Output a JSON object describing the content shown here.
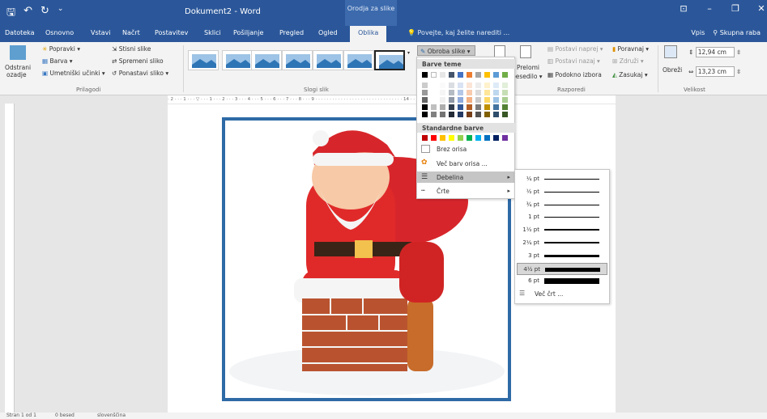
{
  "titlebar": {
    "title": "Dokument2 - Word",
    "context_tab": "Orodja za slike"
  },
  "tabs": [
    "Datoteka",
    "Osnovno",
    "Vstavi",
    "Načrt",
    "Postavitev",
    "Sklici",
    "Pošiljanje",
    "Pregled",
    "Ogled",
    "Oblika"
  ],
  "active_tab": "Oblika",
  "tell_me": "Povejte, kaj želite narediti ...",
  "account": {
    "signin": "Vpis",
    "share": "Skupna raba"
  },
  "ribbon": {
    "adjust": {
      "remove_bg": "Odstrani",
      "remove_bg2": "ozadje",
      "corrections": "Popravki ▾",
      "color": "Barva ▾",
      "artistic": "Umetniški učinki ▾",
      "compress": "Stisni slike",
      "change": "Spremeni sliko",
      "reset": "Ponastavi sliko ▾",
      "group": "Prilagodi"
    },
    "styles_group": "Slogi slik",
    "border_btn": "Obroba slike ▾",
    "arrange": {
      "position": "Prelomi",
      "wrap": "besedilo ▾",
      "bring_forward": "Postavi naprej ▾",
      "send_backward": "Postavi nazaj ▾",
      "selection_pane": "Podokno izbora",
      "align": "Poravnaj ▾",
      "group": "Združi ▾",
      "rotate": "Zasukaj ▾",
      "group_label": "Razporedi"
    },
    "size": {
      "crop": "Obreži",
      "height": "12,94 cm",
      "width": "13,23 cm",
      "group_label": "Velikost"
    }
  },
  "dropdown": {
    "theme_colors": "Barve teme",
    "standard_colors": "Standardne barve",
    "no_outline": "Brez orisa",
    "more_colors": "Več barv orisa ...",
    "weight": "Debelina",
    "dashes": "Črte"
  },
  "weights": [
    {
      "label": "¼ pt",
      "w": 0.25
    },
    {
      "label": "½ pt",
      "w": 0.5
    },
    {
      "label": "¾ pt",
      "w": 0.75
    },
    {
      "label": "1 pt",
      "w": 1
    },
    {
      "label": "1½ pt",
      "w": 1.5
    },
    {
      "label": "2¼ pt",
      "w": 2.25
    },
    {
      "label": "3 pt",
      "w": 3
    },
    {
      "label": "4½ pt",
      "w": 4.5
    },
    {
      "label": "6 pt",
      "w": 6
    }
  ],
  "selected_weight": "4½ pt",
  "more_lines": "Več črt ...",
  "status": {
    "page": "Stran 1 od 1",
    "words": "0 besed",
    "lang": "slovenščina"
  },
  "colors": {
    "theme": [
      "#000000",
      "#ffffff",
      "#e7e6e6",
      "#44546a",
      "#4472c4",
      "#ed7d31",
      "#a5a5a5",
      "#ffc000",
      "#5b9bd5",
      "#70ad47"
    ],
    "standard": [
      "#c00000",
      "#ff0000",
      "#ffc000",
      "#ffff00",
      "#92d050",
      "#00b050",
      "#00b0f0",
      "#0070c0",
      "#002060",
      "#7030a0"
    ],
    "accent": "#2b579a",
    "border": "#2e6aa6"
  }
}
